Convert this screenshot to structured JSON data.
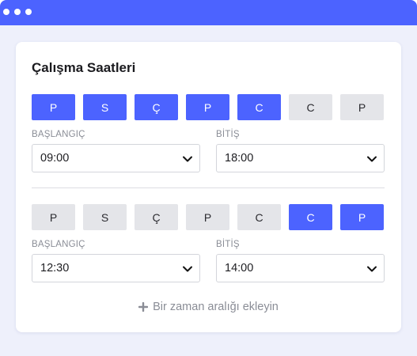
{
  "window": {
    "dots": 3
  },
  "card": {
    "title": "Çalışma Saatleri",
    "ranges": [
      {
        "days": [
          {
            "label": "P",
            "active": true
          },
          {
            "label": "S",
            "active": true
          },
          {
            "label": "Ç",
            "active": true
          },
          {
            "label": "P",
            "active": true
          },
          {
            "label": "C",
            "active": true
          },
          {
            "label": "C",
            "active": false
          },
          {
            "label": "P",
            "active": false
          }
        ],
        "start_label": "BAŞLANGIÇ",
        "start_value": "09:00",
        "end_label": "BİTİŞ",
        "end_value": "18:00"
      },
      {
        "days": [
          {
            "label": "P",
            "active": false
          },
          {
            "label": "S",
            "active": false
          },
          {
            "label": "Ç",
            "active": false
          },
          {
            "label": "P",
            "active": false
          },
          {
            "label": "C",
            "active": false
          },
          {
            "label": "C",
            "active": true
          },
          {
            "label": "P",
            "active": true
          }
        ],
        "start_label": "BAŞLANGIÇ",
        "start_value": "12:30",
        "end_label": "BİTİŞ",
        "end_value": "14:00"
      }
    ],
    "add_range_label": "Bir zaman aralığı ekleyin"
  },
  "colors": {
    "accent": "#4c63ff",
    "inactive_day": "#e4e5e9",
    "background": "#eef0fb"
  }
}
